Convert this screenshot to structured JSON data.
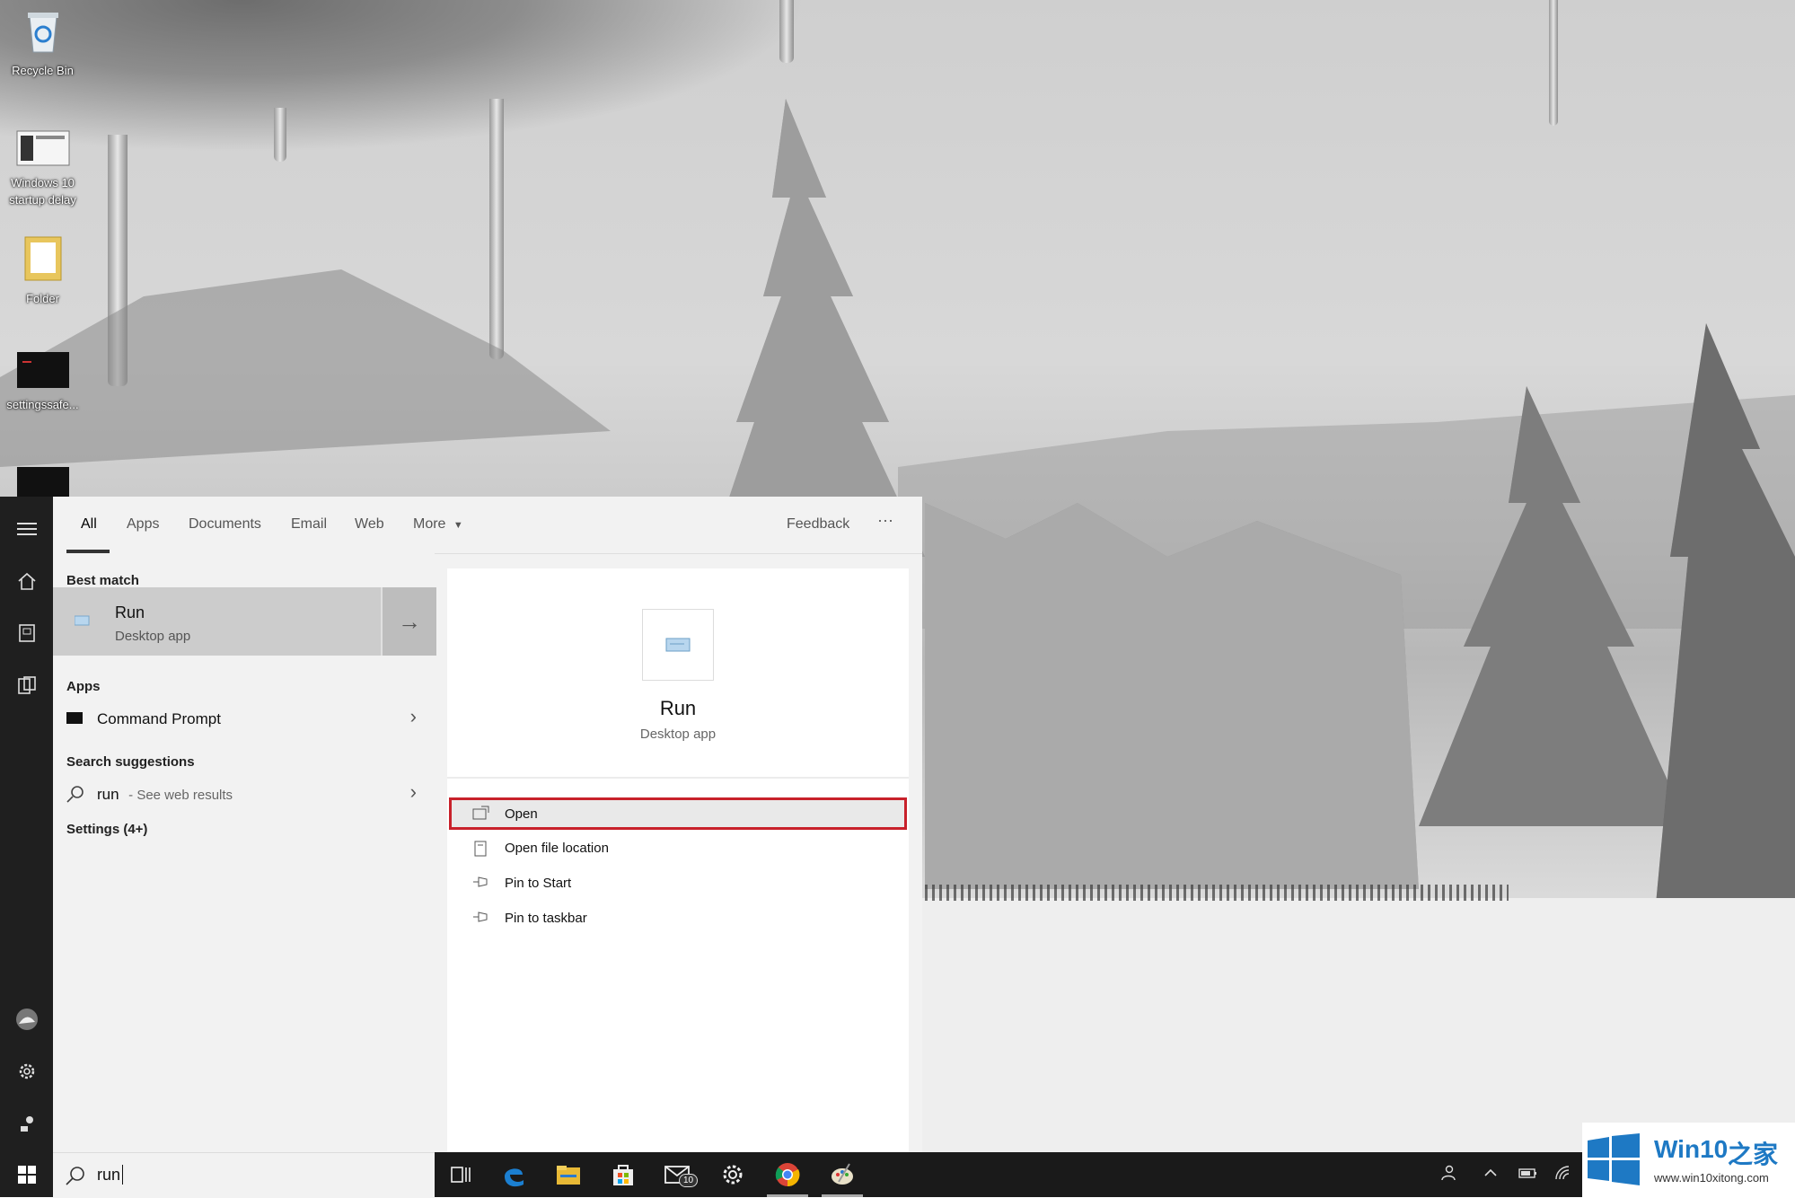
{
  "desktop": {
    "icons": [
      {
        "label": "Recycle Bin",
        "icon": "recycle-bin-icon"
      },
      {
        "label": "Windows 10\nstartup delay",
        "icon": "screenshot-file-icon"
      },
      {
        "label": "Folder",
        "icon": "folder-icon"
      },
      {
        "label": "settingssafe...",
        "icon": "dark-file-icon"
      },
      {
        "label": "",
        "icon": "dark-file-icon"
      }
    ]
  },
  "start_rail": {
    "items": [
      "menu-icon",
      "home-icon",
      "documents-icon",
      "apps-icon",
      "user-avatar-icon",
      "settings-gear-icon",
      "user-accounts-icon",
      "windows-start-icon"
    ]
  },
  "tabs": {
    "all": "All",
    "apps": "Apps",
    "documents": "Documents",
    "email": "Email",
    "web": "Web",
    "more": "More",
    "feedback": "Feedback",
    "overflow": "···"
  },
  "results": {
    "best_match_header": "Best match",
    "best_title": "Run",
    "best_subtitle": "Desktop app",
    "apps_header": "Apps",
    "app_item": "Command Prompt",
    "suggestions_header": "Search suggestions",
    "suggestion_term": "run",
    "suggestion_suffix": " - See web results",
    "settings_header": "Settings (4+)"
  },
  "preview": {
    "title": "Run",
    "subtitle": "Desktop app",
    "actions": [
      {
        "label": "Open",
        "icon": "open-window-icon",
        "selected": true
      },
      {
        "label": "Open file location",
        "icon": "file-location-icon",
        "selected": false
      },
      {
        "label": "Pin to Start",
        "icon": "pin-icon",
        "selected": false
      },
      {
        "label": "Pin to taskbar",
        "icon": "pin-icon",
        "selected": false
      }
    ]
  },
  "search": {
    "value": "run",
    "icon": "search-icon"
  },
  "taskbar": {
    "icons": [
      "task-view-icon",
      "edge-icon",
      "file-explorer-icon",
      "store-icon",
      "mail-icon",
      "settings-gear-icon",
      "chrome-icon",
      "paint-icon"
    ],
    "mail_badge": "10",
    "tray": [
      "people-icon",
      "chevron-up-icon",
      "battery-icon",
      "wifi-icon"
    ]
  },
  "watermark": {
    "brand": "Win10",
    "brand_suffix": "之家",
    "url": "www.win10xitong.com"
  },
  "colors": {
    "accent_red": "#c8212b",
    "taskbar_bg": "#1a1a1a",
    "panel_bg": "#f2f2f2",
    "watermark_blue": "#1e79c4"
  }
}
